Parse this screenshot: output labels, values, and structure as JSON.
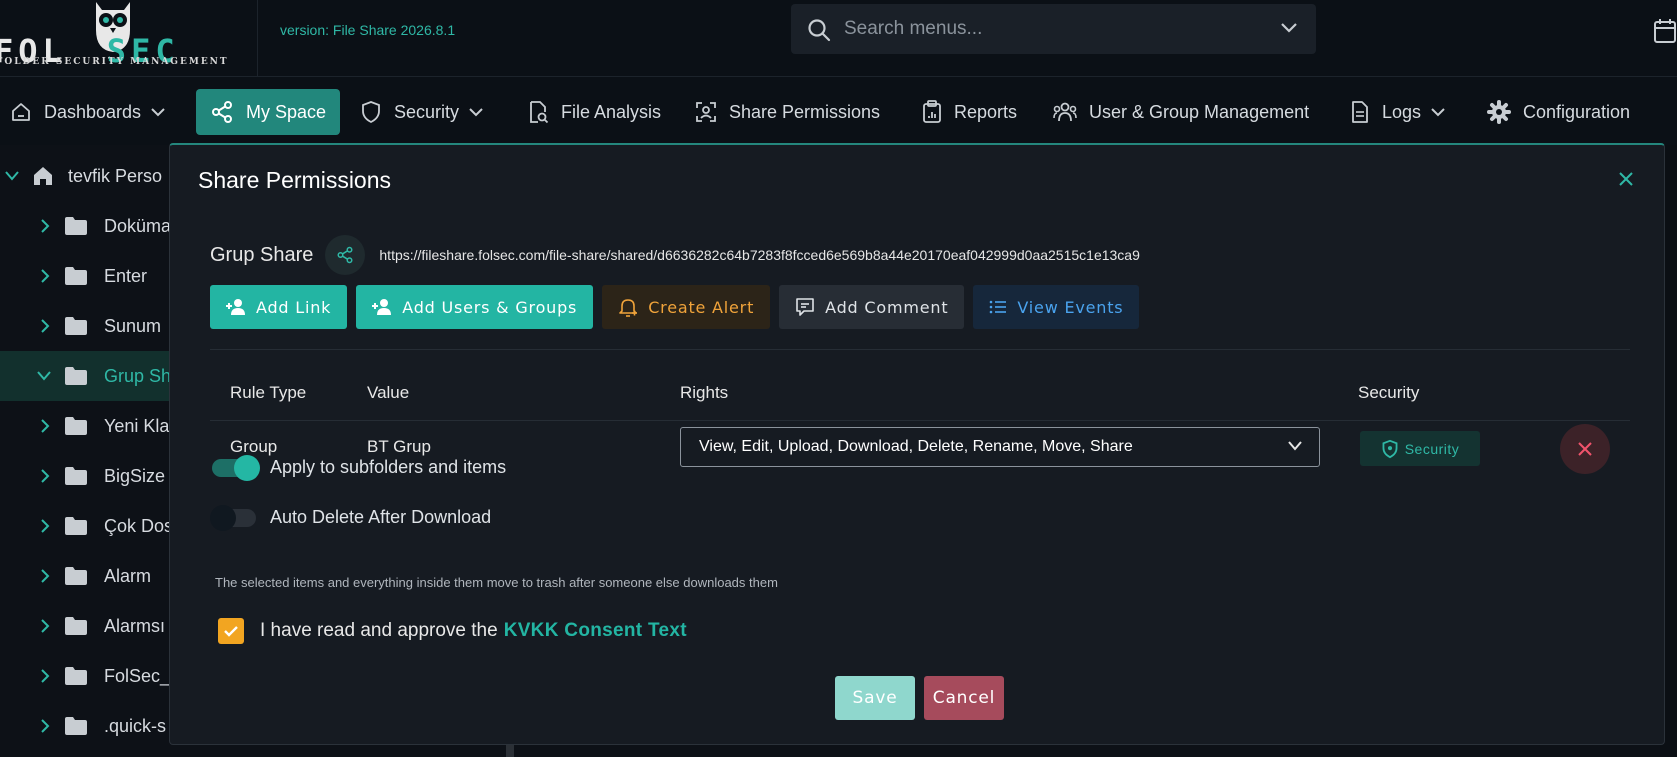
{
  "header": {
    "logo_text_left": "FOL",
    "logo_text_right": "SEC",
    "logo_subtitle": "FOLDER SECURITY MANAGEMENT",
    "version": "version: File Share 2026.8.1",
    "search_placeholder": "Search menus..."
  },
  "nav": {
    "items": [
      {
        "label": "Dashboards",
        "icon": "home-icon",
        "dropdown": true
      },
      {
        "label": "My Space",
        "icon": "share-nodes-icon",
        "active": true
      },
      {
        "label": "Security",
        "icon": "shield-icon",
        "dropdown": true
      },
      {
        "label": "File Analysis",
        "icon": "file-search-icon"
      },
      {
        "label": "Share Permissions",
        "icon": "scan-icon"
      },
      {
        "label": "Reports",
        "icon": "clipboard-icon"
      },
      {
        "label": "User & Group Management",
        "icon": "users-icon"
      },
      {
        "label": "Logs",
        "icon": "document-icon",
        "dropdown": true
      },
      {
        "label": "Configuration",
        "icon": "gear-icon"
      }
    ]
  },
  "tree": {
    "root": "tevfik Perso",
    "items": [
      {
        "label": "Doküma"
      },
      {
        "label": "Enter"
      },
      {
        "label": "Sunum"
      },
      {
        "label": "Grup Sh",
        "selected": true,
        "expanded": true
      },
      {
        "label": "Yeni Kla"
      },
      {
        "label": "BigSize"
      },
      {
        "label": "Çok Dos"
      },
      {
        "label": "Alarm"
      },
      {
        "label": "Alarmsı"
      },
      {
        "label": "FolSec_"
      },
      {
        "label": ".quick-s"
      }
    ]
  },
  "modal": {
    "title": "Share Permissions",
    "share_name": "Grup Share",
    "share_url": "https://fileshare.folsec.com/file-share/shared/d6636282c64b7283f8fcced6e569b8a44e20170eaf042999d0aa2515c1e13ca9",
    "buttons": {
      "add_link": "Add Link",
      "add_users_groups": "Add Users & Groups",
      "create_alert": "Create Alert",
      "add_comment": "Add Comment",
      "view_events": "View Events"
    },
    "table": {
      "headers": [
        "Rule Type",
        "Value",
        "Rights",
        "Security"
      ],
      "rows": [
        {
          "rule_type": "Group",
          "value": "BT Grup",
          "rights": "View, Edit, Upload, Download, Delete, Rename, Move, Share",
          "security": "Security"
        }
      ]
    },
    "apply_subfolders": {
      "label": "Apply to subfolders and items",
      "on": true
    },
    "auto_delete": {
      "label": "Auto Delete After Download",
      "on": false
    },
    "hint": "The selected items and everything inside them move to trash after someone else downloads them",
    "consent": {
      "checked": true,
      "text": "I have read and approve the",
      "link": "KVKK Consent Text"
    },
    "save": "Save",
    "cancel": "Cancel"
  },
  "colors": {
    "accent": "#23b5a3",
    "alert": "#f0a33a",
    "info": "#4aa3ee",
    "danger": "#a64b5c"
  }
}
